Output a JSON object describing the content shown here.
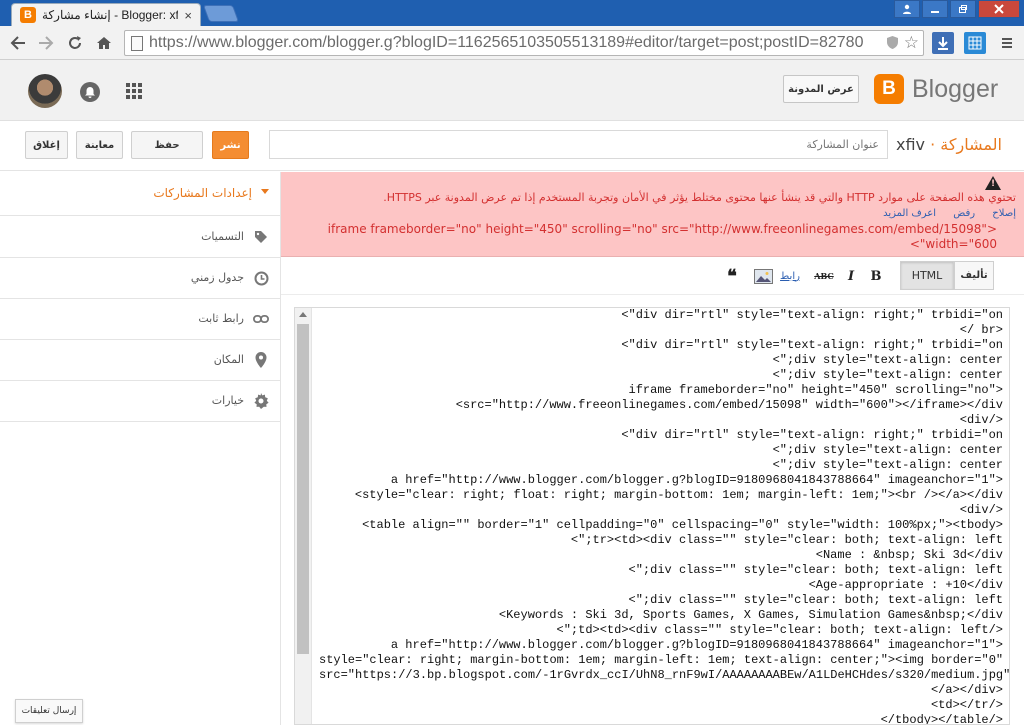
{
  "browser": {
    "tab_title": "إنشاء مشاركة - Blogger: xfiv",
    "tab_close": "×",
    "url": "https://www.blogger.com/blogger.g?blogID=1162565103505513189#editor/target=post;postID=82780"
  },
  "header": {
    "view_blog_label": "عرض المدونة",
    "brand": "Blogger"
  },
  "postbar": {
    "close_label": "إغلاق",
    "preview_label": "معاينة",
    "save_label": "حفظ",
    "publish_label": "نشر",
    "title_placeholder": "عنوان المشاركة",
    "section_label": "المشاركة",
    "separator": "·",
    "blog_name": "xfiv"
  },
  "sidebar": {
    "header": "إعدادات المشاركات",
    "items": [
      {
        "label": "التسميات",
        "icon": "tag-icon"
      },
      {
        "label": "جدول زمني",
        "icon": "clock-icon"
      },
      {
        "label": "رابط ثابت",
        "icon": "link-icon"
      },
      {
        "label": "المكان",
        "icon": "location-pin-icon"
      },
      {
        "label": "خيارات",
        "icon": "gear-icon"
      }
    ],
    "comments_button": "إرسال تعليقات"
  },
  "warning": {
    "message": "تحتوي هذه الصفحة على موارد HTTP والتي قد ينشأ عنها محتوى مختلط يؤثر في الأمان وتجربة المستخدم إذا تم عرض المدونة عبر HTTPS.",
    "links": [
      "إصلاح",
      "رفض",
      "اعرف المزيد"
    ],
    "code_lines": [
      "iframe frameborder=\"no\" height=\"450\" scrolling=\"no\" src=\"http://www.freeonlinegames.com/embed/15098\">",
      "<\"width=\"600"
    ]
  },
  "editor": {
    "mode_html": "HTML",
    "mode_compose": "تأليف",
    "bold": "B",
    "italic": "I",
    "strike": "ABC",
    "link": "رابط",
    "quote": "❝",
    "code_lines": [
      "<\"div dir=\"rtl\" style=\"text-align: right;\" trbidi=\"on",
      "</ br>",
      "<\"div dir=\"rtl\" style=\"text-align: right;\" trbidi=\"on",
      "<\";div style=\"text-align: center",
      "<\";div style=\"text-align: center",
      "iframe frameborder=\"no\" height=\"450\" scrolling=\"no\">",
      "<src=\"http://www.freeonlinegames.com/embed/15098\" width=\"600\"></iframe></div",
      "<div/>",
      "<\"div dir=\"rtl\" style=\"text-align: right;\" trbidi=\"on",
      "<\";div style=\"text-align: center",
      "<\";div style=\"text-align: center",
      "a href=\"http://www.blogger.com/blogger.g?blogID=9180968041843788664\" imageanchor=\"1\">",
      "<style=\"clear: right; float: right; margin-bottom: 1em; margin-left: 1em;\"><br /></a></div",
      "<div/>",
      "<table align=\"\" border=\"1\" cellpadding=\"0\" cellspacing=\"0\" style=\"width: 100%px;\"><tbody>",
      "<\";tr><td><div class=\"\" style=\"clear: both; text-align: left",
      "<Name : &nbsp; Ski 3d</div",
      "<\";div class=\"\" style=\"clear: both; text-align: left",
      "<Age-appropriate : +10</div",
      "<\";div class=\"\" style=\"clear: both; text-align: left",
      "<Keywords : Ski 3d, Sports Games, X Games, Simulation Games&nbsp;</div",
      "<\";td><td><div class=\"\" style=\"clear: both; text-align: left/>",
      "a href=\"http://www.blogger.com/blogger.g?blogID=9180968041843788664\" imageanchor=\"1\">",
      "style=\"clear: right; margin-bottom: 1em; margin-left: 1em; text-align: center;\"><img border=\"0\"",
      "src=\"https://3.bp.blogspot.com/-1rGvrdx_ccI/UhN8_rnF9wI/AAAAAAAABEw/A1LDeHCHdes/s320/medium.jpg\"",
      "</a></div>",
      "<td></tr/>",
      "</tbody></table/>"
    ]
  }
}
